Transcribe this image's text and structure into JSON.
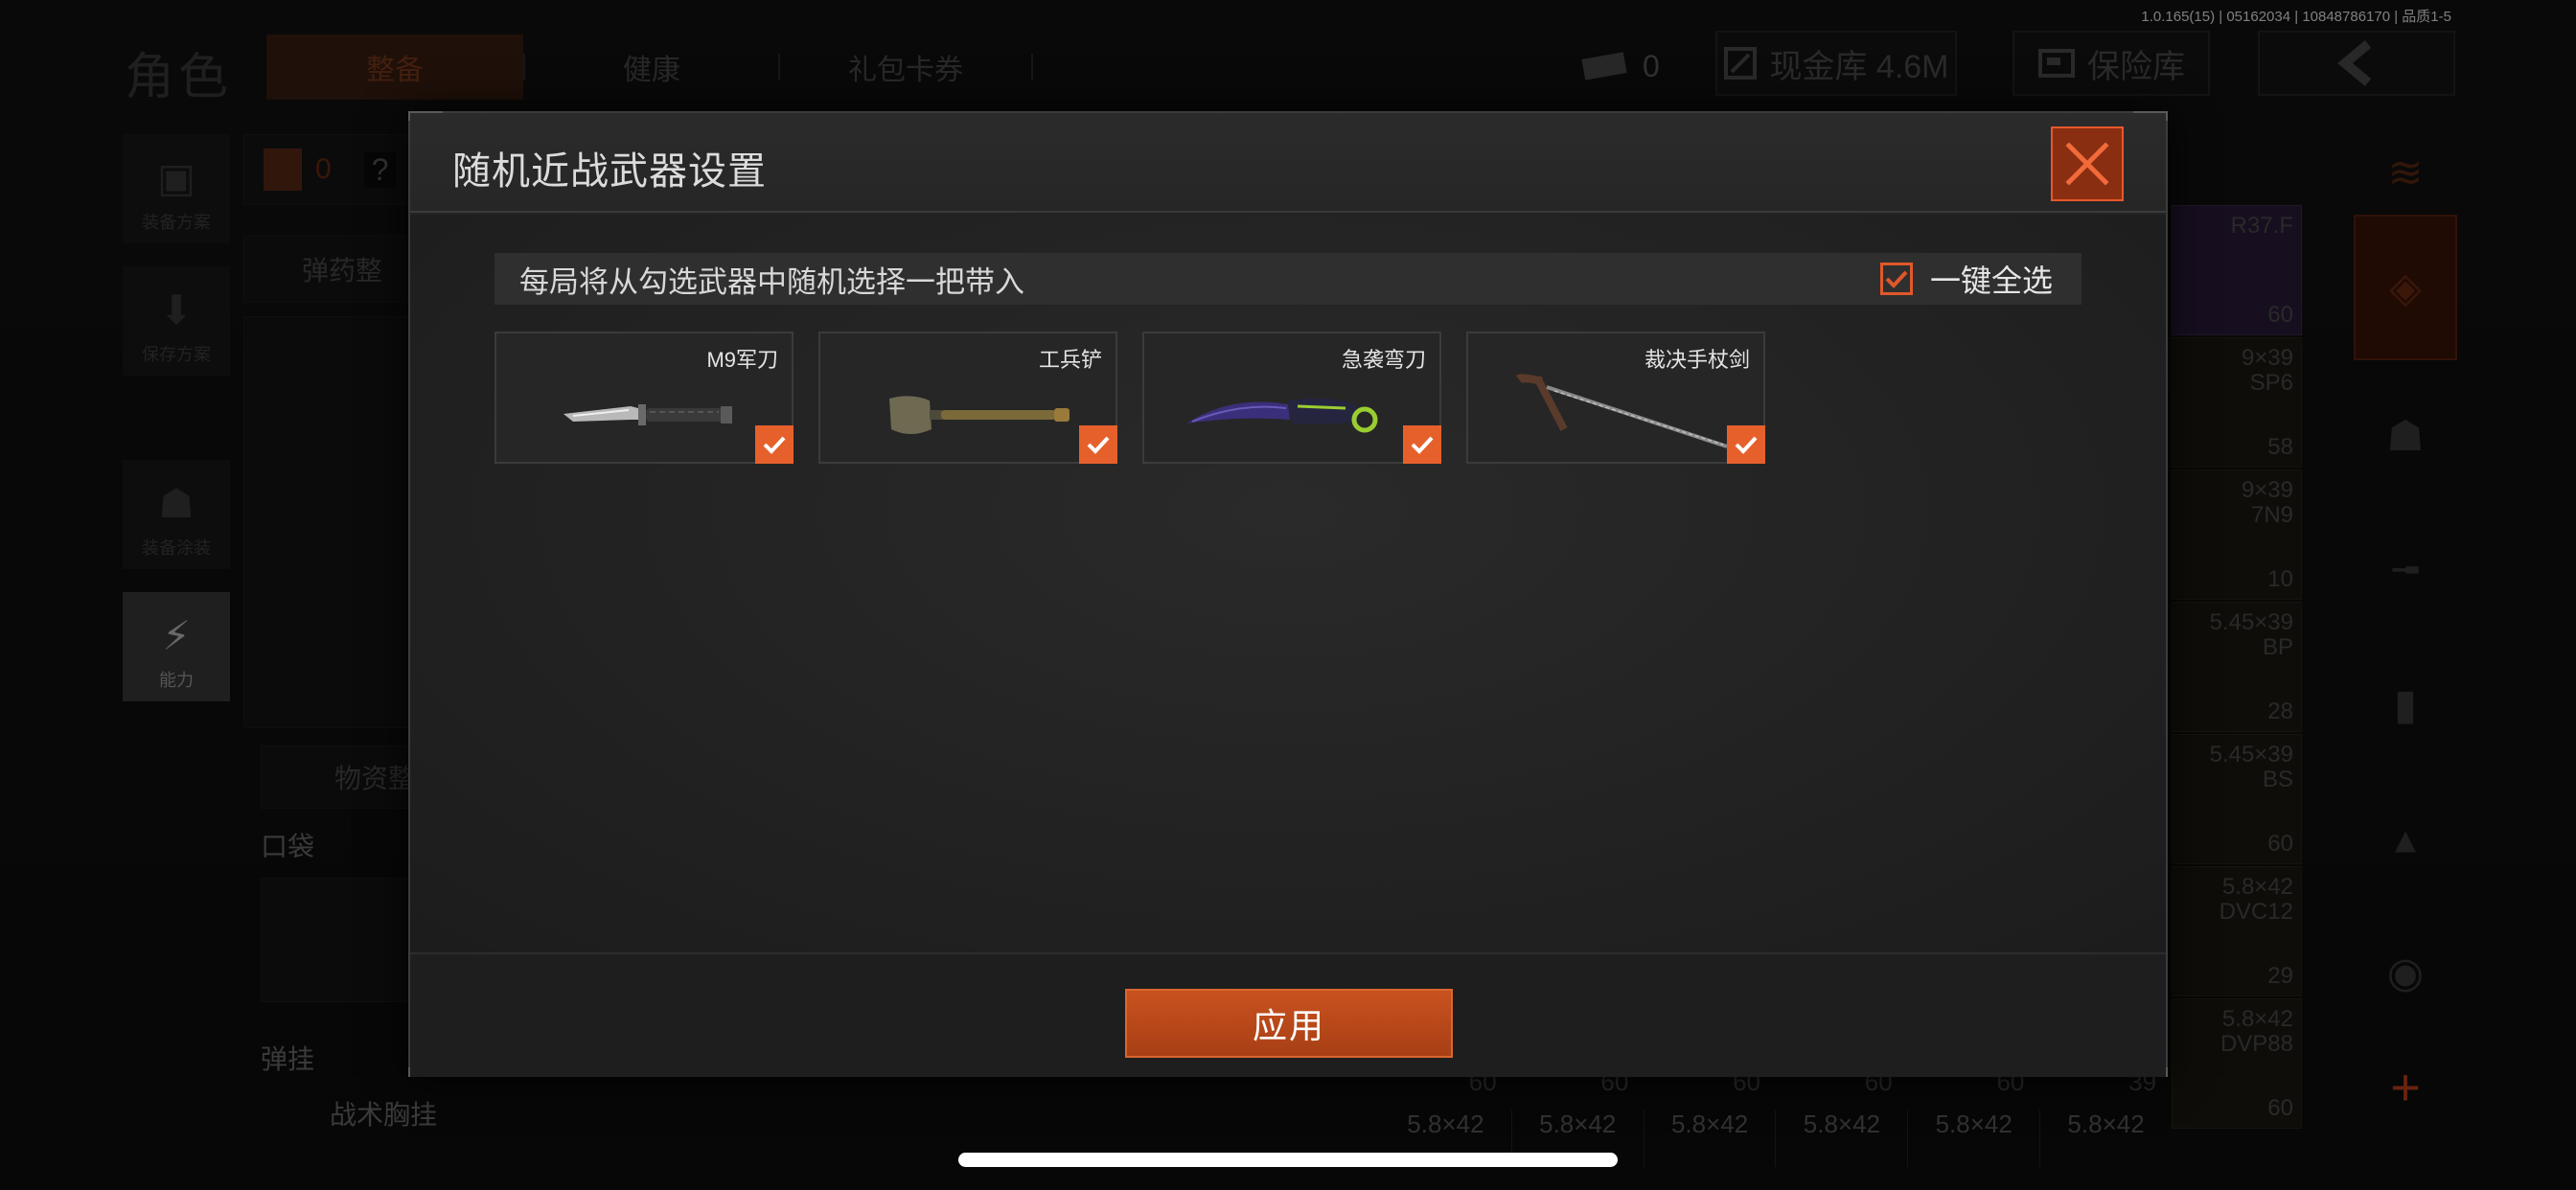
{
  "status": {
    "version": "1.0.165(15) | 05162034 | 10848786170 | 品质1-5"
  },
  "header": {
    "page_title": "角色",
    "tabs": [
      {
        "label": "整备"
      },
      {
        "label": "健康"
      },
      {
        "label": "礼包卡券"
      }
    ],
    "ticket_count": "0",
    "cash_vault": "现金库 4.6M",
    "safe_box": "保险库"
  },
  "sidebar": {
    "items": [
      {
        "label": "装备方案"
      },
      {
        "label": "保存方案"
      },
      {
        "label": "装备涂装"
      },
      {
        "label": "能力"
      }
    ]
  },
  "loadout": {
    "armor_count": "0",
    "ammo_section": "弹药整",
    "supply_section": "物资整",
    "pocket_label": "口袋",
    "hang_label": "弹挂",
    "chest_rig_label": "战术胸挂"
  },
  "ammo_grid": {
    "cells": [
      {
        "caption": "R37.F",
        "count": "60"
      },
      {
        "caption": "9×39\nSP6",
        "count": "58"
      },
      {
        "caption": "9×39\n7N9",
        "count": "10"
      },
      {
        "caption": "5.45×39\nBP",
        "count": "28"
      },
      {
        "caption": "5.45×39\nBS",
        "count": "60"
      },
      {
        "caption": "5.8×42\nDVC12",
        "count": "29"
      },
      {
        "caption": "5.8×42\nDVP88",
        "count": "60"
      }
    ],
    "bottom_counts": [
      "60",
      "60",
      "60",
      "60",
      "60",
      "39"
    ],
    "bottom_caption": "5.8×42"
  },
  "modal": {
    "title": "随机近战武器设置",
    "info": "每局将从勾选武器中随机选择一把带入",
    "select_all": "一键全选",
    "select_all_checked": true,
    "apply": "应用",
    "weapons": [
      {
        "name": "M9军刀",
        "icon": "bayonet-knife-icon",
        "checked": true
      },
      {
        "name": "工兵铲",
        "icon": "shovel-icon",
        "checked": true
      },
      {
        "name": "急袭弯刀",
        "icon": "karambit-icon",
        "checked": true
      },
      {
        "name": "裁决手杖剑",
        "icon": "cane-sword-icon",
        "checked": true
      }
    ]
  },
  "colors": {
    "accent": "#e6602c",
    "close_bg": "#8a2e12",
    "apply_bg": "#b84818"
  }
}
